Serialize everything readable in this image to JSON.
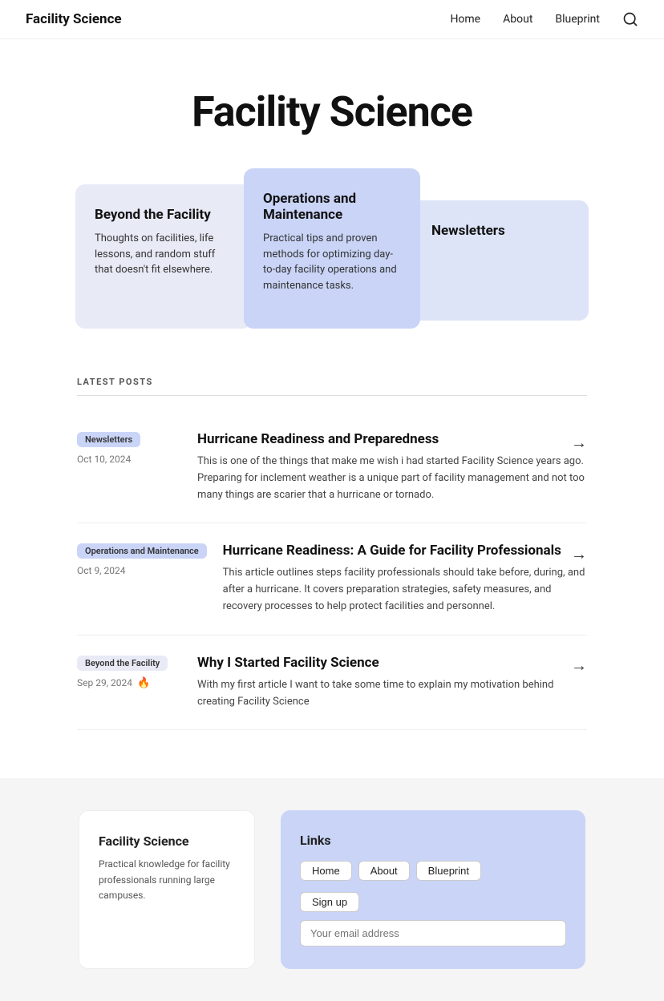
{
  "nav": {
    "logo": "Facility Science",
    "links": [
      {
        "label": "Home",
        "id": "home"
      },
      {
        "label": "About",
        "id": "about"
      },
      {
        "label": "Blueprint",
        "id": "blueprint"
      }
    ]
  },
  "hero": {
    "title": "Facility Science"
  },
  "cards": {
    "beyond": {
      "title": "Beyond the Facility",
      "description": "Thoughts on facilities, life lessons, and random stuff that doesn't fit elsewhere."
    },
    "ops": {
      "title": "Operations and Maintenance",
      "description": "Practical tips and proven methods for optimizing day-to-day facility operations and maintenance tasks."
    },
    "newsletters": {
      "title": "Newsletters"
    }
  },
  "latest": {
    "section_label": "LATEST POSTS",
    "posts": [
      {
        "tag": "Newsletters",
        "tag_class": "ops",
        "date": "Oct 10, 2024",
        "title": "Hurricane Readiness and Preparedness",
        "description": "This is one of the things that make me wish i had started Facility Science years ago. Preparing for inclement weather is a unique part of facility management and not too many things are scarier that a hurricane or tornado."
      },
      {
        "tag": "Operations and Maintenance",
        "tag_class": "ops",
        "date": "Oct 9, 2024",
        "title": "Hurricane Readiness: A Guide for Facility Professionals",
        "description": "This article outlines steps facility professionals should take before, during, and after a hurricane. It covers preparation strategies, safety measures, and recovery processes to help protect facilities and personnel."
      },
      {
        "tag": "Beyond the Facility",
        "tag_class": "beyond",
        "date": "Sep 29, 2024",
        "has_fire": true,
        "title": "Why I Started Facility Science",
        "description": "With my first article I want to take some time to explain my motivation behind creating Facility Science"
      }
    ]
  },
  "footer": {
    "left": {
      "title": "Facility Science",
      "description": "Practical knowledge for facility professionals running large campuses."
    },
    "right": {
      "title": "Links",
      "links": [
        "Home",
        "About",
        "Blueprint"
      ],
      "signup": "Sign up",
      "email_placeholder": "Your email address"
    }
  }
}
